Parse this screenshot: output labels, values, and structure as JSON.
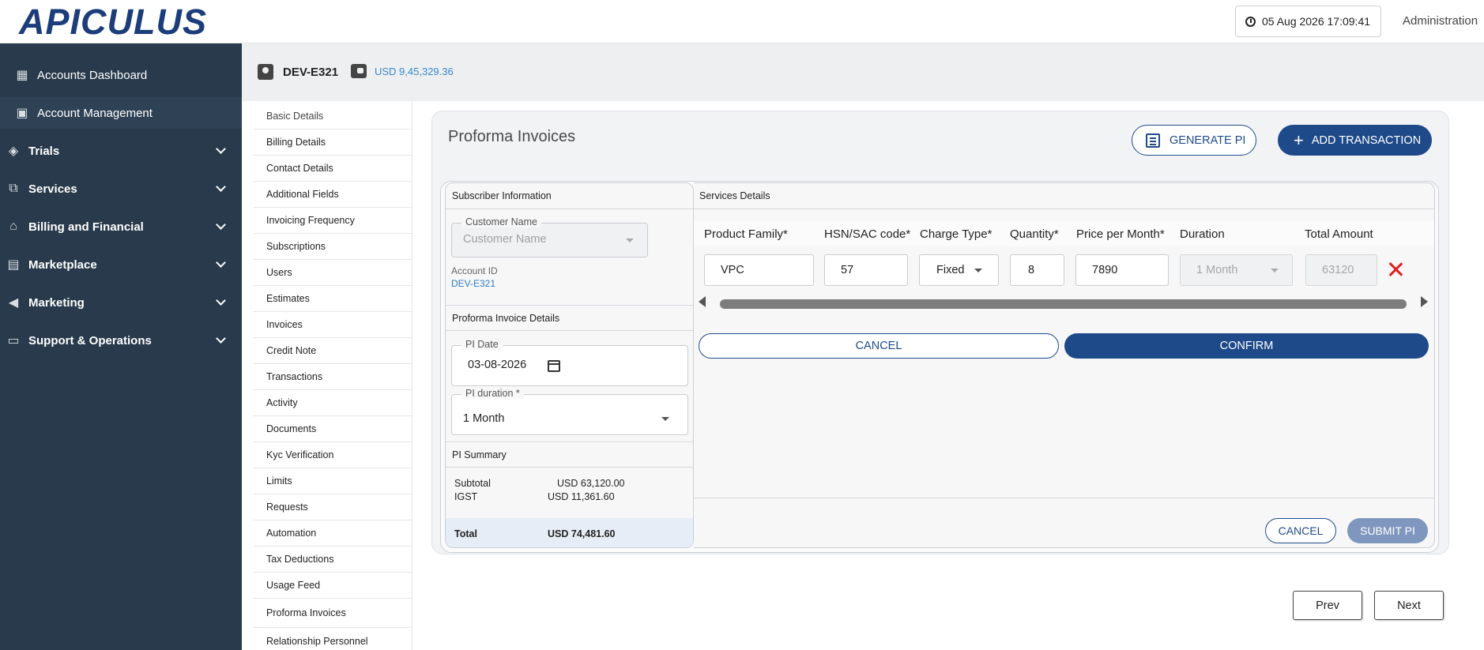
{
  "brand": {
    "logo_text": "APICULUS"
  },
  "header": {
    "datetime": "05 Aug 2026 17:09:41",
    "user_menu": "Administration"
  },
  "sidebar": {
    "items": [
      {
        "label": "Accounts Dashboard",
        "icon": "dashboard-icon",
        "expandable": false
      },
      {
        "label": "Account Management",
        "icon": "account-box-icon",
        "expandable": false
      },
      {
        "label": "Trials",
        "icon": "tag-icon",
        "expandable": true
      },
      {
        "label": "Services",
        "icon": "services-icon",
        "expandable": true
      },
      {
        "label": "Billing and Financial",
        "icon": "bank-icon",
        "expandable": true
      },
      {
        "label": "Marketplace",
        "icon": "store-icon",
        "expandable": true
      },
      {
        "label": "Marketing",
        "icon": "megaphone-icon",
        "expandable": true
      },
      {
        "label": "Support & Operations",
        "icon": "monitor-icon",
        "expandable": true
      }
    ]
  },
  "account_bar": {
    "account_id": "DEV-E321",
    "balance": "USD 9,45,329.36"
  },
  "subnav": {
    "items": [
      "Basic Details",
      "Billing Details",
      "Contact Details",
      "Additional Fields",
      "Invoicing Frequency",
      "Subscriptions",
      "Users",
      "Estimates",
      "Invoices",
      "Credit Note",
      "Transactions",
      "Activity",
      "Documents",
      "Kyc Verification",
      "Limits",
      "Requests",
      "Automation",
      "Tax Deductions",
      "Usage Feed",
      "Proforma Invoices",
      "Relationship Personnel"
    ]
  },
  "page": {
    "title": "Proforma Invoices",
    "generate_pi": "GENERATE PI",
    "add_transaction": "ADD TRANSACTION"
  },
  "subscriber": {
    "heading": "Subscriber Information",
    "customer_name_label": "Customer Name",
    "customer_name_placeholder": "Customer Name",
    "account_id_label": "Account ID",
    "account_id_value": "DEV-E321"
  },
  "pi_details": {
    "heading": "Proforma Invoice Details",
    "date_label": "PI Date",
    "date_value": "03-08-2026",
    "duration_label": "PI duration *",
    "duration_value": "1 Month"
  },
  "pi_summary": {
    "heading": "PI Summary",
    "subtotal_label": "Subtotal",
    "subtotal_value": "USD 63,120.00",
    "igst_label": "IGST",
    "igst_value": "USD 11,361.60",
    "total_label": "Total",
    "total_value": "USD 74,481.60"
  },
  "services": {
    "heading": "Services Details",
    "columns": [
      "Product Family*",
      "HSN/SAC code*",
      "Charge Type*",
      "Quantity*",
      "Price per Month*",
      "Duration",
      "Total Amount"
    ],
    "row": {
      "product_family": "VPC",
      "hsn_sac": "57",
      "charge_type": "Fixed",
      "quantity": "8",
      "price_per_month": "7890",
      "duration": "1 Month",
      "total_amount": "63120"
    },
    "cancel": "CANCEL",
    "confirm": "CONFIRM"
  },
  "footer_actions": {
    "cancel": "CANCEL",
    "submit": "SUBMIT PI"
  },
  "pagination": {
    "prev": "Prev",
    "next": "Next"
  },
  "colors": {
    "brand_navy": "#1f4a8a",
    "sidebar_bg": "#283a4b",
    "link_blue": "#2f7cc0",
    "delete_red": "#e02020"
  }
}
